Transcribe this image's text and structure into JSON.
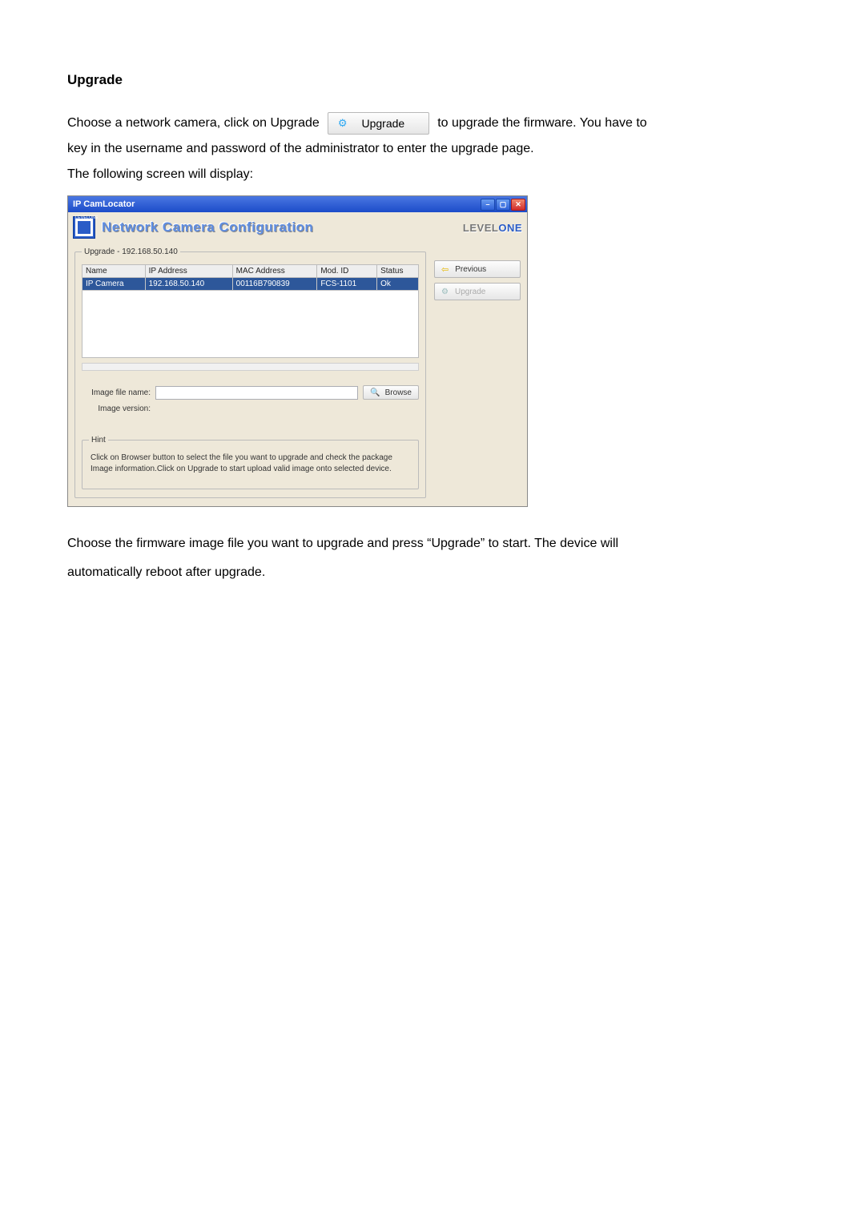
{
  "heading": "Upgrade",
  "intro": {
    "before_button": "Choose a network camera, click on Upgrade",
    "button_label": "Upgrade",
    "after_button": "to upgrade the firmware. You have to",
    "line2": "key in the username and password of the administrator to enter the upgrade page.",
    "line3": "The following screen will display:"
  },
  "window": {
    "title": "IP CamLocator",
    "banner_title": "Network Camera Configuration",
    "brand_prefix": "LEVEL",
    "brand_suffix": "ONE",
    "logo_text": "LEVELONE",
    "fieldset_legend": "Upgrade - 192.168.50.140",
    "table": {
      "headers": [
        "Name",
        "IP Address",
        "MAC Address",
        "Mod. ID",
        "Status"
      ],
      "row": [
        "IP Camera",
        "192.168.50.140",
        "00116B790839",
        "FCS-1101",
        "Ok"
      ]
    },
    "image_file_label": "Image file name:",
    "image_file_value": "",
    "image_version_label": "Image version:",
    "image_version_value": "",
    "browse_label": "Browse",
    "hint_legend": "Hint",
    "hint_text": "Click on Browser button to select the file you want to upgrade and check the package Image information.Click on Upgrade to start upload valid image onto selected device.",
    "side": {
      "previous": "Previous",
      "upgrade": "Upgrade"
    }
  },
  "outro": {
    "line1": "Choose the firmware image file you want to upgrade and press “Upgrade” to start. The device will",
    "line2": "automatically reboot after upgrade."
  }
}
